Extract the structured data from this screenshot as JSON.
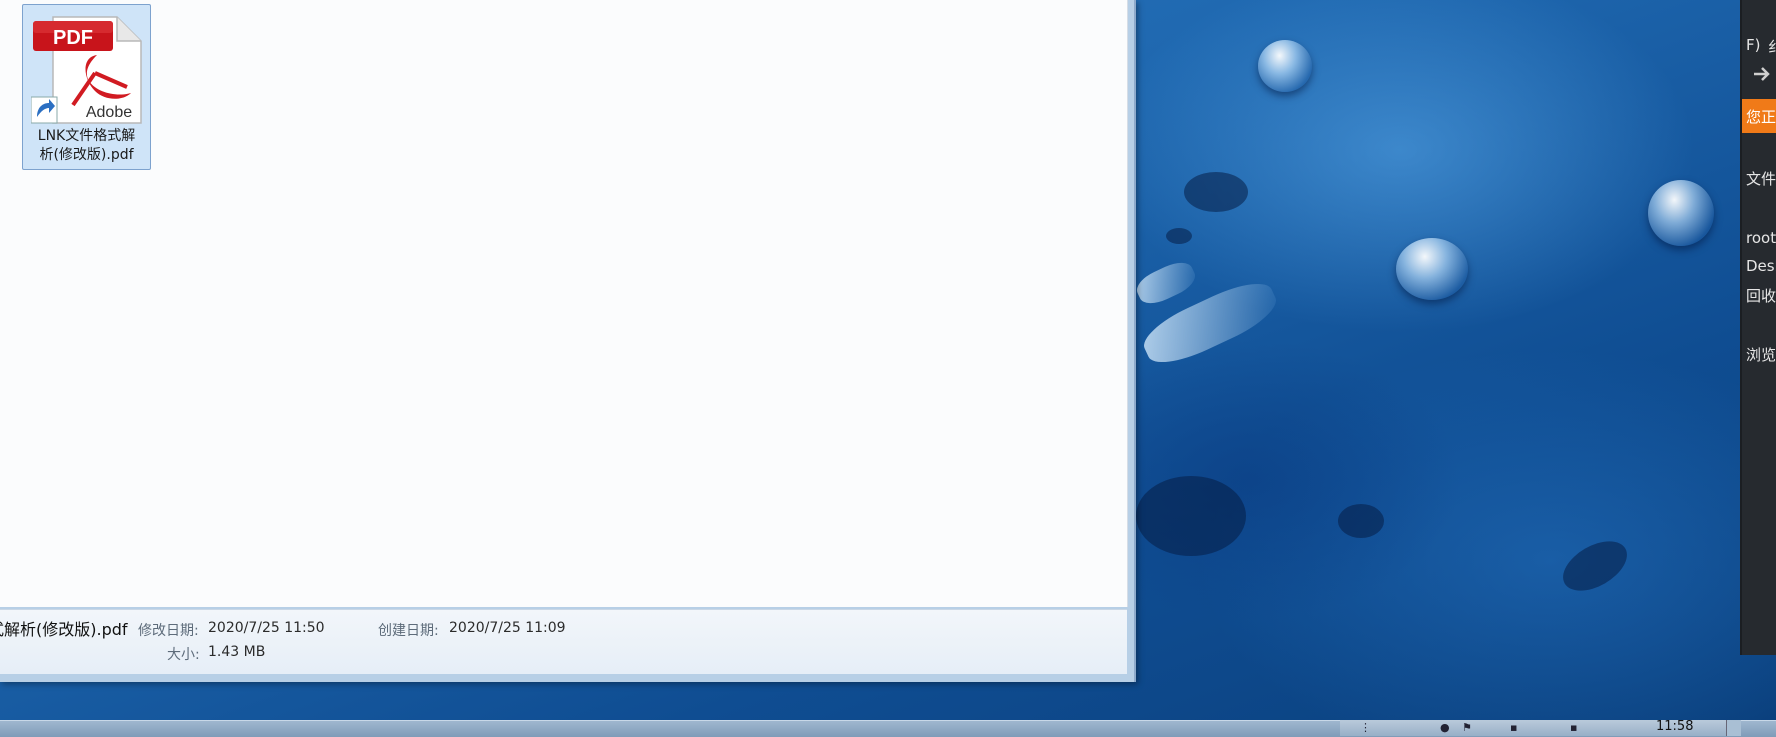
{
  "explorer": {
    "file": {
      "name": "LNK文件格式解\n析(修改版).pdf",
      "icon_text_pdf": "PDF",
      "icon_text_brand": "Adobe"
    },
    "details": {
      "filename_partial": "式解析(修改版).pdf",
      "modified_label": "修改日期:",
      "modified_value": "2020/7/25 11:50",
      "created_label": "创建日期:",
      "created_value": "2020/7/25 11:09",
      "size_label": "大小:",
      "size_value": "1.43 MB"
    }
  },
  "right_panel": {
    "menu_fragment": "F)",
    "menu_fragment2": "纟",
    "notice": "您正",
    "line1": "文件",
    "line2": "root",
    "line3": "Desk",
    "line4": "回收",
    "line5": "浏览",
    "colors": {
      "background": "#262a2f",
      "notice": "#f07a18"
    }
  },
  "taskbar": {
    "clock": "11:58",
    "icons": [
      "keyboard-icon",
      "network-icon",
      "volume-icon",
      "flag-icon"
    ]
  }
}
